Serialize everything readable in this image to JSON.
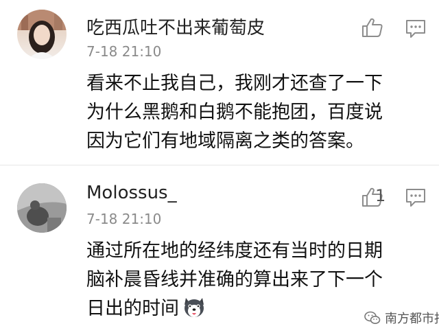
{
  "comments": [
    {
      "username": "吃西瓜吐不出来葡萄皮",
      "time": "7-18 21:10",
      "lines": [
        "看来不止我自己，我刚才还查了一下",
        "为什么黑鹅和白鹅不能抱团，百度说",
        "因为它们有地域隔离之类的答案。"
      ],
      "like_count": ""
    },
    {
      "username": "Molossus_",
      "time": "7-18 21:10",
      "lines": [
        "通过所在地的经纬度还有当时的日期",
        "脑补晨昏线并准确的算出来了下一个",
        "日出的时间"
      ],
      "like_count": "1"
    }
  ],
  "icons": {
    "like": "thumbs-up-icon",
    "reply": "comment-icon",
    "emoji": "husky-dog-emoji-icon",
    "watermark": "wechat-icon"
  },
  "watermark": "南方都市报",
  "colors": {
    "text": "#111111",
    "meta": "#8a8a8a",
    "icon": "#8c8c8c",
    "divider": "#e6e6e6"
  }
}
